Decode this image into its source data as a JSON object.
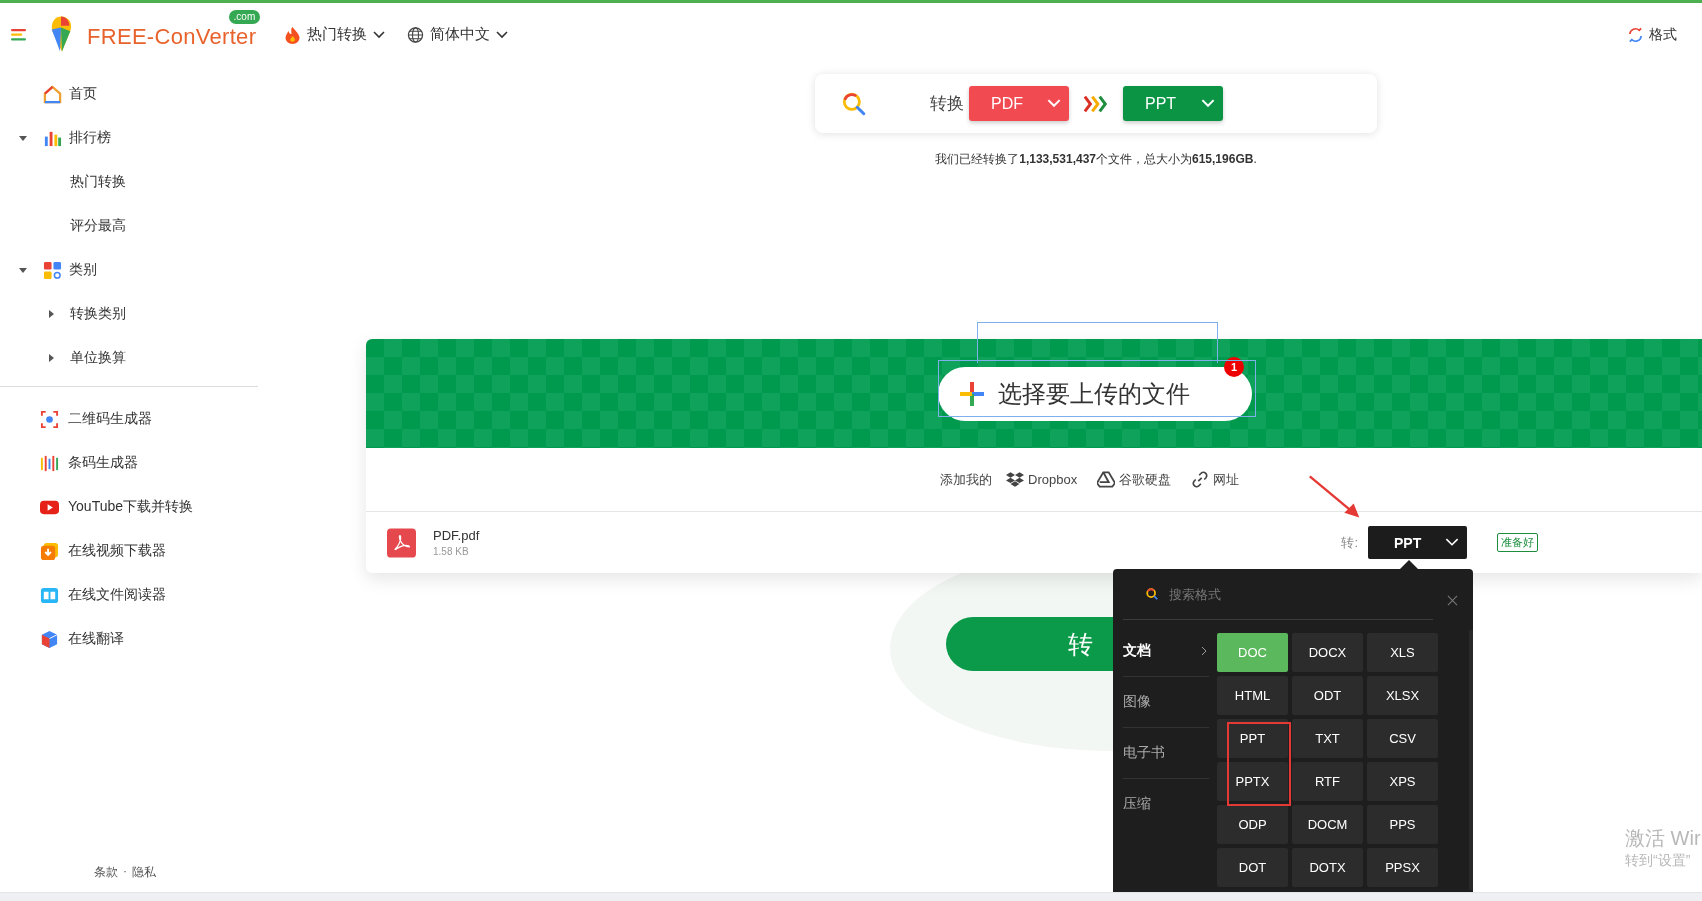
{
  "header": {
    "brand": "FREE-ConVerter",
    "brand_tld": ".com",
    "nav": [
      {
        "kind": "hot",
        "label": "热门转换"
      },
      {
        "kind": "language",
        "label": "简体中文"
      }
    ],
    "formats_link": "格式"
  },
  "sidebar": {
    "items": [
      {
        "kind": "home",
        "label": "首页"
      },
      {
        "kind": "chart",
        "label": "排行榜",
        "expanded": true,
        "children": [
          {
            "label": "热门转换"
          },
          {
            "label": "评分最高"
          }
        ]
      },
      {
        "kind": "category",
        "label": "类别",
        "expanded": true,
        "children": [
          {
            "label": "转换类别",
            "expanded": false
          },
          {
            "label": "单位换算",
            "expanded": false
          }
        ]
      }
    ],
    "tools": [
      {
        "kind": "qr",
        "label": "二维码生成器"
      },
      {
        "kind": "barcode",
        "label": "条码生成器"
      },
      {
        "kind": "youtube",
        "label": "YouTube下载并转换"
      },
      {
        "kind": "video",
        "label": "在线视频下载器"
      },
      {
        "kind": "reader",
        "label": "在线文件阅读器"
      },
      {
        "kind": "translate",
        "label": "在线翻译"
      }
    ],
    "footer": {
      "terms": "条款",
      "separator": "·",
      "privacy": "隐私"
    }
  },
  "search_bar": {
    "label": "转换",
    "from": "PDF",
    "to": "PPT"
  },
  "stats": "我们已经转换了**1,133,531,437**个文件，总大小为**615,196GB**.",
  "upload": {
    "button": "选择要上传的文件",
    "badge": "1",
    "sources_label": "添加我的",
    "sources": [
      {
        "kind": "dropbox",
        "label": "Dropbox"
      },
      {
        "kind": "drive",
        "label": "谷歌硬盘"
      },
      {
        "kind": "url",
        "label": "网址"
      }
    ]
  },
  "file": {
    "name": "PDF.pdf",
    "size": "1.58 KB",
    "to_label": "转:",
    "target": "PPT",
    "status": "准备好"
  },
  "convert_button": "转",
  "format_menu": {
    "placeholder": "搜索格式",
    "categories": [
      {
        "label": "文档",
        "selected": true
      },
      {
        "label": "图像",
        "selected": false
      },
      {
        "label": "电子书",
        "selected": false
      },
      {
        "label": "压缩",
        "selected": false
      }
    ],
    "formats": [
      {
        "label": "DOC",
        "selected": true
      },
      {
        "label": "DOCX",
        "selected": false
      },
      {
        "label": "XLS",
        "selected": false
      },
      {
        "label": "HTML",
        "selected": false
      },
      {
        "label": "ODT",
        "selected": false
      },
      {
        "label": "XLSX",
        "selected": false
      },
      {
        "label": "PPT",
        "selected": false
      },
      {
        "label": "TXT",
        "selected": false
      },
      {
        "label": "CSV",
        "selected": false
      },
      {
        "label": "PPTX",
        "selected": false
      },
      {
        "label": "RTF",
        "selected": false
      },
      {
        "label": "XPS",
        "selected": false
      },
      {
        "label": "ODP",
        "selected": false
      },
      {
        "label": "DOCM",
        "selected": false
      },
      {
        "label": "PPS",
        "selected": false
      },
      {
        "label": "DOT",
        "selected": false
      },
      {
        "label": "DOTX",
        "selected": false
      },
      {
        "label": "PPSX",
        "selected": false
      }
    ]
  },
  "os_watermark": {
    "title": "激活 Wir",
    "subtitle": "转到“设置”"
  }
}
